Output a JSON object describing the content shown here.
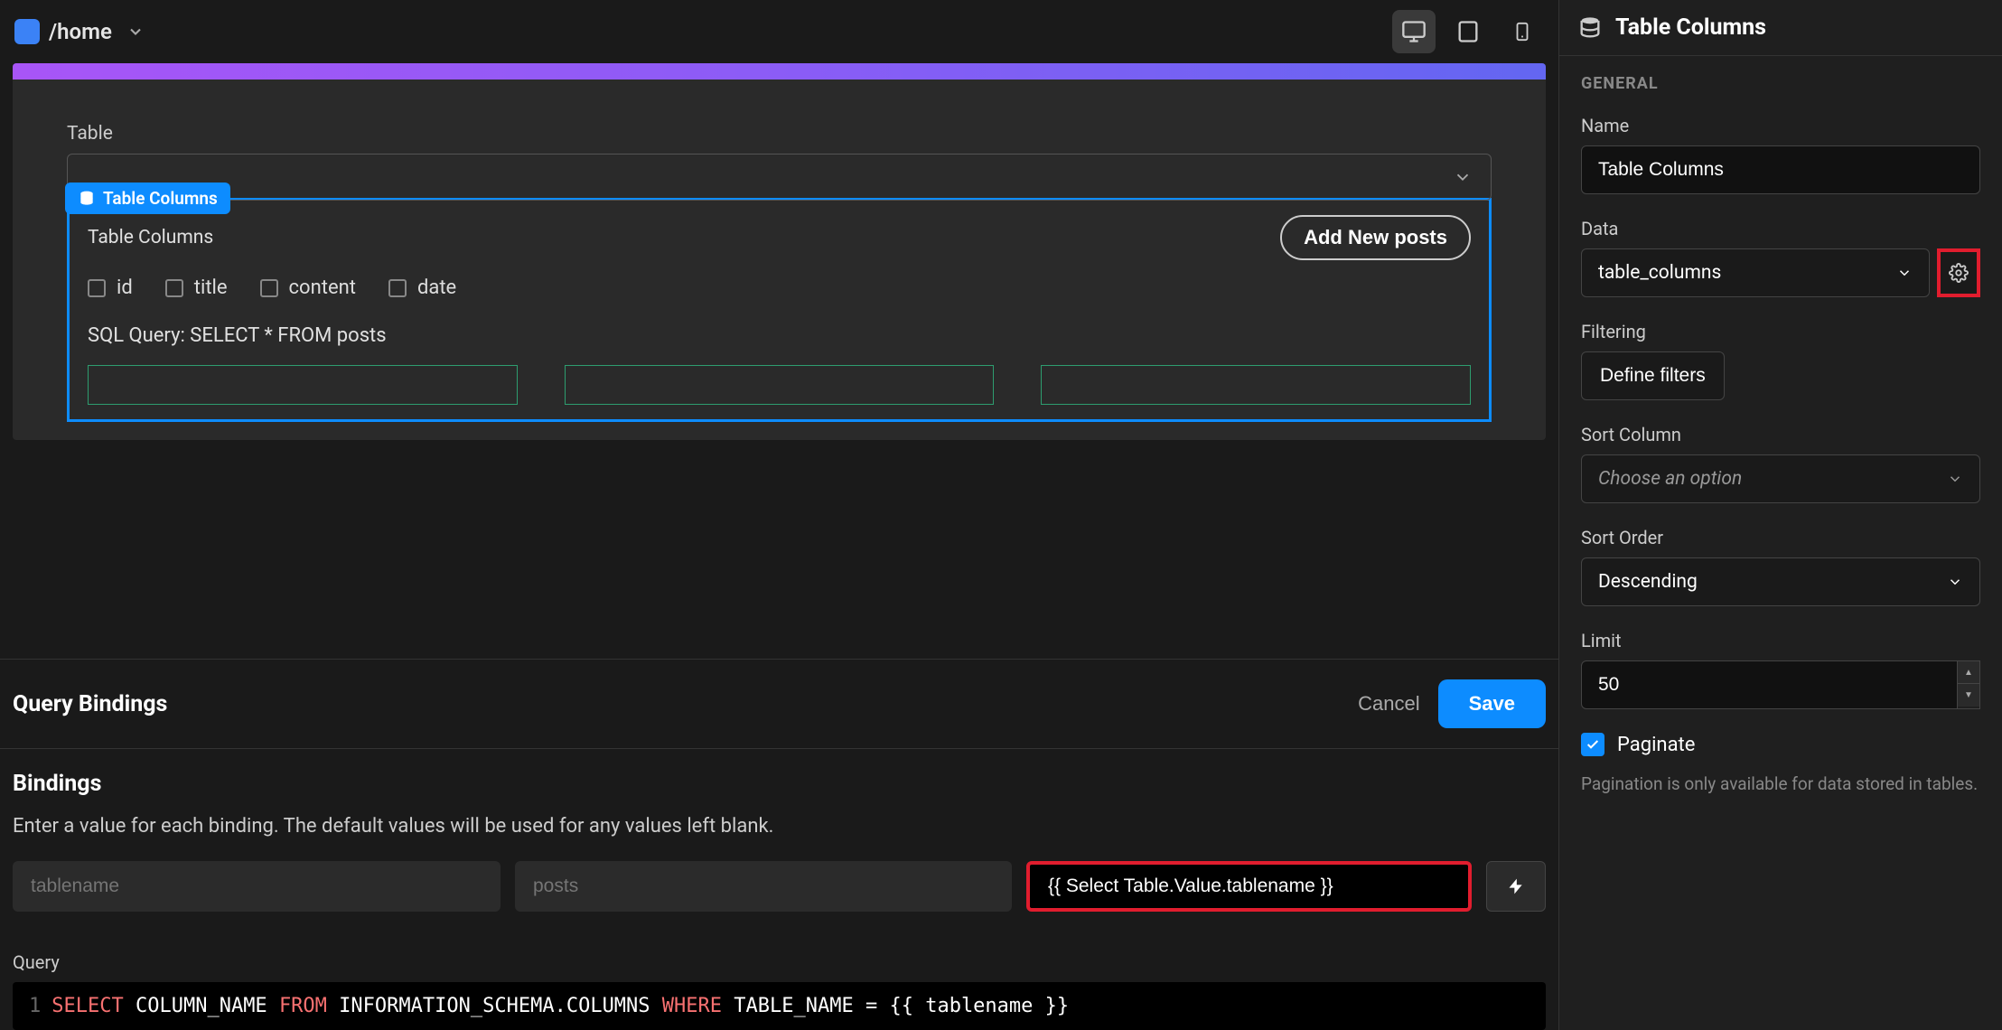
{
  "topbar": {
    "breadcrumb": "/home"
  },
  "canvas": {
    "table_label": "Table",
    "component_tag": "Table Columns",
    "component_title": "Table Columns",
    "add_button": "Add New posts",
    "columns": [
      "id",
      "title",
      "content",
      "date"
    ],
    "sql_label": "SQL Query: SELECT * FROM posts"
  },
  "query_panel": {
    "title": "Query Bindings",
    "cancel": "Cancel",
    "save": "Save",
    "bindings_title": "Bindings",
    "help_text": "Enter a value for each binding. The default values will be used for any values left blank.",
    "binding_name_placeholder": "tablename",
    "binding_default_placeholder": "posts",
    "binding_value": "{{ Select Table.Value.tablename }}",
    "query_label": "Query",
    "query_tokens": {
      "select": "SELECT",
      "col": "COLUMN_NAME",
      "from": "FROM",
      "schema": "INFORMATION_SCHEMA.COLUMNS",
      "where": "WHERE",
      "cond": "TABLE_NAME = {{ tablename }}"
    }
  },
  "sidebar": {
    "title": "Table Columns",
    "section_general": "GENERAL",
    "name_label": "Name",
    "name_value": "Table Columns",
    "data_label": "Data",
    "data_value": "table_columns",
    "filtering_label": "Filtering",
    "filter_button": "Define filters",
    "sortcol_label": "Sort Column",
    "sortcol_placeholder": "Choose an option",
    "sortorder_label": "Sort Order",
    "sortorder_value": "Descending",
    "limit_label": "Limit",
    "limit_value": "50",
    "paginate_label": "Paginate",
    "paginate_help": "Pagination is only available for data stored in tables."
  }
}
